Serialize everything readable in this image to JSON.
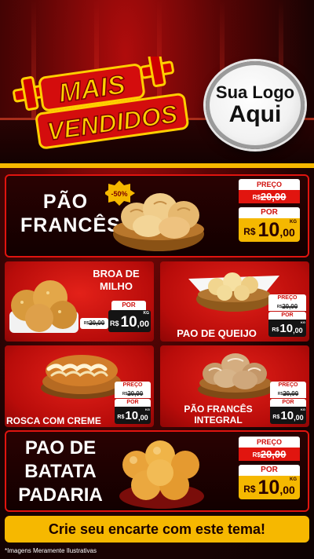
{
  "header": {
    "mais": "MAIS",
    "vendidos": "VENDIDOS",
    "logo_line1": "Sua Logo",
    "logo_line2": "Aqui"
  },
  "products": {
    "pao_frances": {
      "title_l1": "PÃO",
      "title_l2": "FRANCÊS",
      "discount": "-50%",
      "preco_label": "PREÇO",
      "old_currency": "R$",
      "old_price": "20,00",
      "por_label": "POR",
      "currency": "R$",
      "price_int": "10",
      "price_dec": ",00",
      "unit": "KG"
    },
    "broa": {
      "title_l1": "BROA DE",
      "title_l2": "MILHO",
      "por_label": "POR",
      "old_currency": "R$",
      "old_price": "20,00",
      "currency": "R$",
      "price_int": "10",
      "price_dec": ",00",
      "unit": "KG"
    },
    "queijo": {
      "title": "PAO DE QUEIJO",
      "preco_label": "PREÇO",
      "old_currency": "R$",
      "old_price": "20,00",
      "por_label": "POR",
      "currency": "R$",
      "price_int": "10",
      "price_dec": ",00",
      "unit": "KG"
    },
    "rosca": {
      "title": "ROSCA COM CREME",
      "preco_label": "PREÇO",
      "old_currency": "R$",
      "old_price": "20,00",
      "por_label": "POR",
      "currency": "R$",
      "price_int": "10",
      "price_dec": ",00",
      "unit": "KG"
    },
    "integral": {
      "title_l1": "PÃO FRANCÊS",
      "title_l2": "INTEGRAL",
      "preco_label": "PREÇO",
      "old_currency": "R$",
      "old_price": "20,00",
      "por_label": "POR",
      "currency": "R$",
      "price_int": "10",
      "price_dec": ",00",
      "unit": "KG"
    },
    "batata": {
      "title_l1": "PAO DE",
      "title_l2": "BATATA",
      "title_l3": "PADARIA",
      "preco_label": "PREÇO",
      "old_currency": "R$",
      "old_price": "20,00",
      "por_label": "POR",
      "currency": "R$",
      "price_int": "10",
      "price_dec": ",00",
      "unit": "KG"
    }
  },
  "cta": "Crie seu encarte com este tema!",
  "footnote": "*Imagens Meramente Ilustrativas",
  "colors": {
    "brand_red": "#e1150f",
    "accent_yellow": "#f5b800",
    "dark": "#120000"
  }
}
